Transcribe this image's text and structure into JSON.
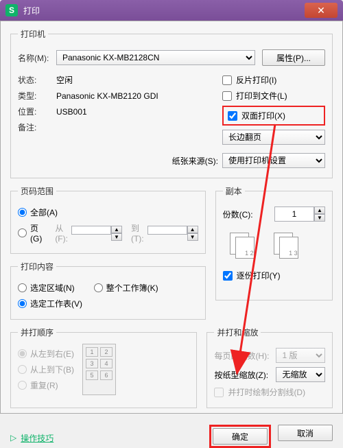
{
  "titlebar": {
    "icon_letter": "S",
    "title": "打印",
    "close_glyph": "✕"
  },
  "printer": {
    "legend": "打印机",
    "name_label": "名称(M):",
    "name_value": "Panasonic KX-MB2128CN",
    "props_btn": "属性(P)...",
    "status_label": "状态:",
    "status_value": "空闲",
    "type_label": "类型:",
    "type_value": "Panasonic KX-MB2120 GDI",
    "loc_label": "位置:",
    "loc_value": "USB001",
    "note_label": "备注:",
    "reverse_chk": "反片打印(I)",
    "tofile_chk": "打印到文件(L)",
    "duplex_chk": "双面打印(X)",
    "flip_option": "长边翻页",
    "papersrc_label": "纸张来源(S):",
    "papersrc_value": "使用打印机设置"
  },
  "page_range": {
    "legend": "页码范围",
    "all": "全部(A)",
    "pages": "页(G)",
    "from_label": "从(F):",
    "to_label": "到(T):"
  },
  "copies": {
    "legend": "副本",
    "count_label": "份数(C):",
    "count_value": "1",
    "collate": "逐份打印(Y)"
  },
  "content": {
    "legend": "打印内容",
    "sel_region": "选定区域(N)",
    "whole_book": "整个工作簿(K)",
    "sel_sheet": "选定工作表(V)"
  },
  "order": {
    "legend": "并打顺序",
    "lr": "从左到右(E)",
    "tb": "从上到下(B)",
    "repeat": "重复(R)"
  },
  "scale": {
    "legend": "并打和缩放",
    "perpage_label": "每页的版数(H):",
    "perpage_value": "1 版",
    "papertype_label": "按纸型缩放(Z):",
    "papertype_value": "无缩放",
    "cutline": "并打时绘制分割线(D)"
  },
  "footer": {
    "tip": "操作技巧",
    "ok": "确定",
    "cancel": "取消",
    "tip_icon": "▷"
  },
  "colors": {
    "red": "#e22",
    "green": "#0fb36a"
  }
}
